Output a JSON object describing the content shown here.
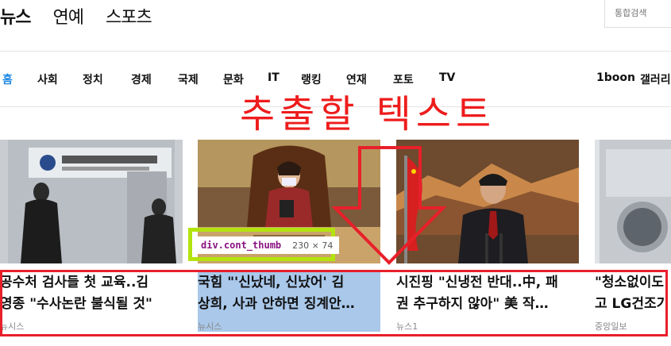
{
  "top_tabs": [
    "뉴스",
    "연예",
    "스포츠"
  ],
  "search": {
    "placeholder": "통합검색"
  },
  "nav": {
    "items": [
      "홈",
      "사회",
      "정치",
      "경제",
      "국제",
      "문화",
      "IT",
      "랭킹",
      "연재",
      "포토",
      "TV"
    ],
    "right_items": [
      "1boon",
      "갤러리"
    ],
    "active": "홈",
    "active_color": "#1e88e5"
  },
  "overlay_label": "추출할 텍스트",
  "devtools_tooltip": {
    "selector": "div.cont_thumb",
    "size": "230 × 74"
  },
  "cards": [
    {
      "title_lines": [
        "공수처 검사들 첫 교육..김",
        "영종 \"수사논란 불식될 것\""
      ],
      "source": "뉴시스",
      "image": "photo-agency-building"
    },
    {
      "title_lines": [
        "국힘 \"'신났네, 신났어' 김",
        "상희, 사과 안하면 징계안…"
      ],
      "source": "뉴시스",
      "image": "photo-parliament-speaker"
    },
    {
      "title_lines": [
        "시진핑 \"신냉전 반대..中, 패",
        "권 추구하지 않아\" 美 작…"
      ],
      "source": "뉴스1",
      "image": "photo-xi-jinping"
    },
    {
      "title_lines": [
        "\"청소없이도",
        "고 LG건조기"
      ],
      "source": "중앙일보",
      "image": "photo-appliance"
    }
  ],
  "colors": {
    "annotation_red": "#e8202a",
    "tooltip_border": "#b3e30f",
    "highlight": "#a9c8ea"
  }
}
